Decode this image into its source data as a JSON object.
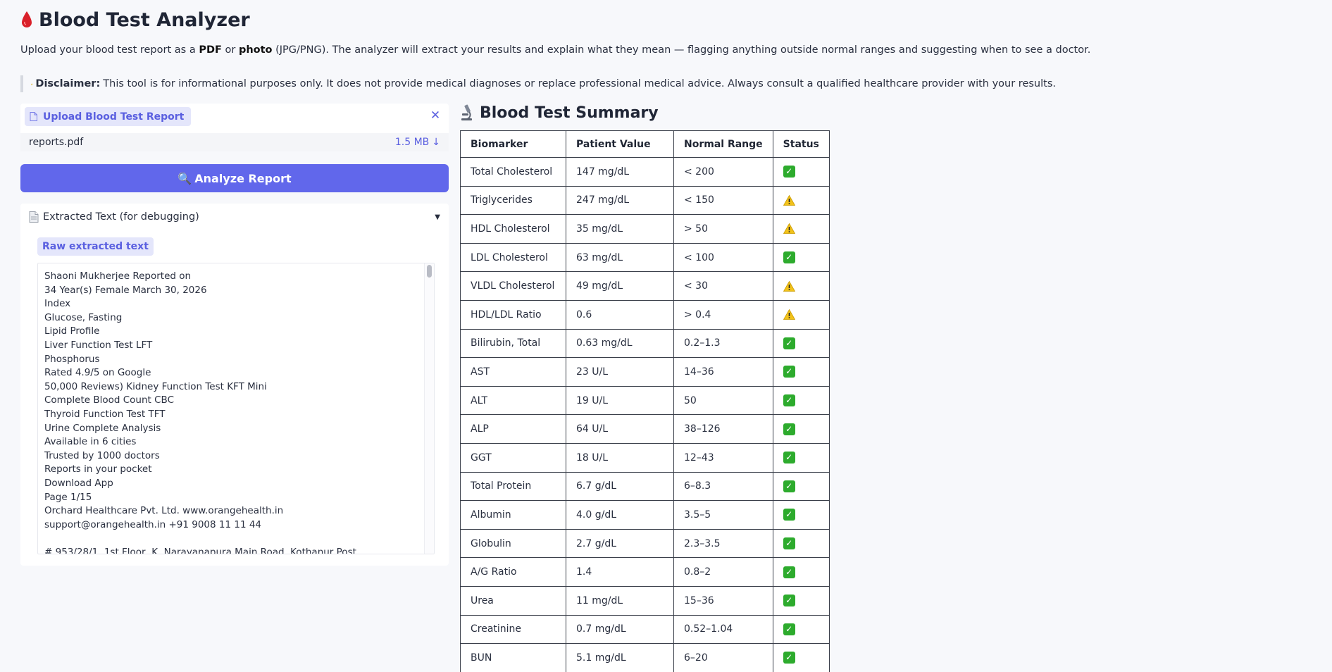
{
  "app": {
    "title": "Blood Test Analyzer",
    "title_icon": "blood-drop-icon"
  },
  "intro": {
    "before_pdf": "Upload your blood test report as a ",
    "pdf": "PDF",
    "middle": " or ",
    "photo": "photo",
    "after": " (JPG/PNG). The analyzer will extract your results and explain what they mean — flagging anything outside normal ranges and suggesting when to see a doctor."
  },
  "disclaimer": {
    "label": "Disclaimer:",
    "text": "This tool is for informational purposes only. It does not provide medical diagnoses or replace professional medical advice. Always consult a qualified healthcare provider with your results."
  },
  "upload": {
    "label": "Upload Blood Test Report",
    "file_name": "reports.pdf",
    "file_size": "1.5 MB",
    "download_glyph": "↓",
    "close_glyph": "✕"
  },
  "analyze_button": {
    "icon": "🔍",
    "label": "Analyze Report"
  },
  "debug": {
    "header": "Extracted Text (for debugging)",
    "toggle_glyph": "▼",
    "tab_label": "Raw extracted text",
    "lines": [
      "Shaoni Mukherjee Reported on",
      "34 Year(s) Female March 30, 2026",
      "Index",
      "Glucose, Fasting",
      "Lipid Profile",
      "Liver Function Test LFT",
      "Phosphorus",
      "Rated 4.9/5 on Google",
      "50,000 Reviews) Kidney Function Test KFT Mini",
      "Complete Blood Count CBC",
      "Thyroid Function Test TFT",
      "Urine Complete Analysis",
      "Available in 6 cities",
      "Trusted by 1000 doctors",
      "Reports in your pocket",
      "Download App",
      "Page 1/15",
      "Orchard Healthcare Pvt. Ltd. www.orangehealth.in",
      "support@orangehealth.in +91 9008 11 11 44",
      "",
      "# 953/28/1, 1st Floor, K. Narayanapura Main Road, Kothanur Post"
    ]
  },
  "summary": {
    "title": "Blood Test Summary",
    "title_icon": "microscope-icon",
    "columns": [
      "Biomarker",
      "Patient Value",
      "Normal Range",
      "Status"
    ],
    "rows": [
      {
        "biomarker": "Total Cholesterol",
        "value": "147 mg/dL",
        "range": "< 200",
        "status": "ok"
      },
      {
        "biomarker": "Triglycerides",
        "value": "247 mg/dL",
        "range": "< 150",
        "status": "warning"
      },
      {
        "biomarker": "HDL Cholesterol",
        "value": "35 mg/dL",
        "range": "> 50",
        "status": "warning"
      },
      {
        "biomarker": "LDL Cholesterol",
        "value": "63 mg/dL",
        "range": "< 100",
        "status": "ok"
      },
      {
        "biomarker": "VLDL Cholesterol",
        "value": "49 mg/dL",
        "range": "< 30",
        "status": "warning"
      },
      {
        "biomarker": "HDL/LDL Ratio",
        "value": "0.6",
        "range": "> 0.4",
        "status": "warning"
      },
      {
        "biomarker": "Bilirubin, Total",
        "value": "0.63 mg/dL",
        "range": "0.2–1.3",
        "status": "ok"
      },
      {
        "biomarker": "AST",
        "value": "23 U/L",
        "range": "14–36",
        "status": "ok"
      },
      {
        "biomarker": "ALT",
        "value": "19 U/L",
        "range": "50",
        "status": "ok"
      },
      {
        "biomarker": "ALP",
        "value": "64 U/L",
        "range": "38–126",
        "status": "ok"
      },
      {
        "biomarker": "GGT",
        "value": "18 U/L",
        "range": "12–43",
        "status": "ok"
      },
      {
        "biomarker": "Total Protein",
        "value": "6.7 g/dL",
        "range": "6–8.3",
        "status": "ok"
      },
      {
        "biomarker": "Albumin",
        "value": "4.0 g/dL",
        "range": "3.5–5",
        "status": "ok"
      },
      {
        "biomarker": "Globulin",
        "value": "2.7 g/dL",
        "range": "2.3–3.5",
        "status": "ok"
      },
      {
        "biomarker": "A/G Ratio",
        "value": "1.4",
        "range": "0.8–2",
        "status": "ok"
      },
      {
        "biomarker": "Urea",
        "value": "11 mg/dL",
        "range": "15–36",
        "status": "ok"
      },
      {
        "biomarker": "Creatinine",
        "value": "0.7 mg/dL",
        "range": "0.52–1.04",
        "status": "ok"
      },
      {
        "biomarker": "BUN",
        "value": "5.1 mg/dL",
        "range": "6–20",
        "status": "ok"
      }
    ]
  },
  "colors": {
    "accent": "#6167eb",
    "accent_light": "#e4e6fb",
    "ok": "#2dab2d",
    "warning": "#f2c21a",
    "background": "#f7f8fb"
  }
}
